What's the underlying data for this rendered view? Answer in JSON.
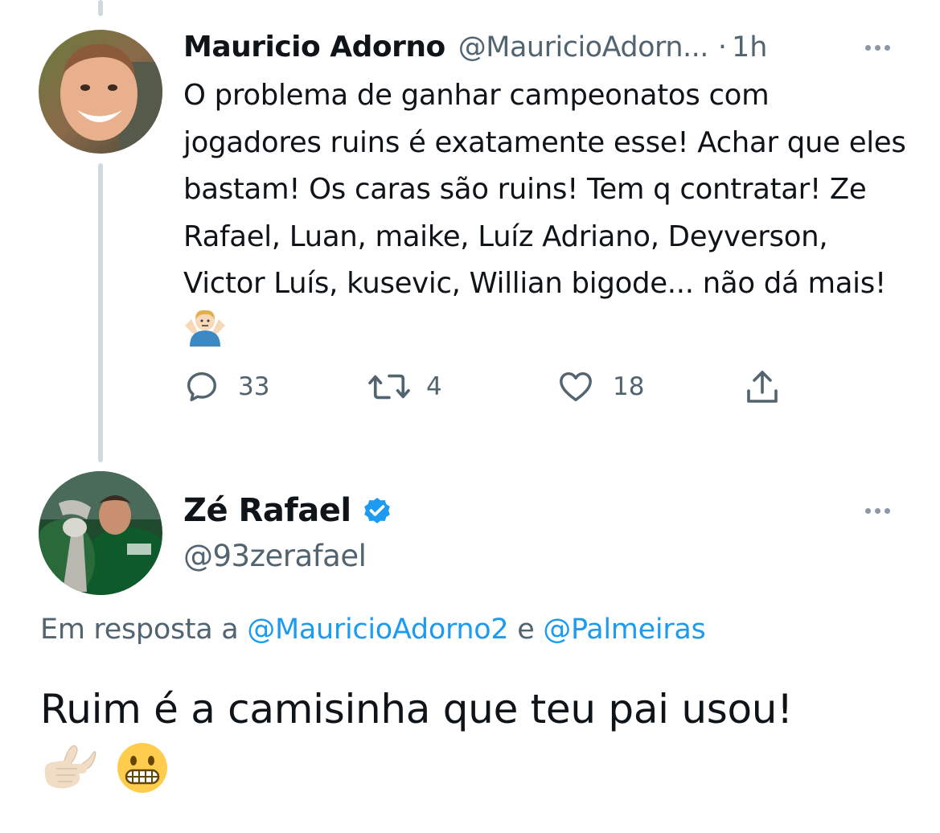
{
  "tweet1": {
    "name": "Mauricio Adorno",
    "handle": "@MauricioAdorn...",
    "separator": "·",
    "time": "1h",
    "text": "O problema de ganhar campeonatos com jogadores ruins é exatamente esse! Achar que eles bastam! Os caras são ruins! Tem q contratar! Ze Rafael, Luan, maike, Luíz Adriano, Deyverson, Victor Luís, kusevic, Willian bigode... não dá mais!",
    "text_emoji": "man-shrugging-emoji",
    "replies": "33",
    "retweets": "4",
    "likes": "18"
  },
  "tweet2": {
    "name": "Zé Rafael",
    "verified": true,
    "handle": "@93zerafael",
    "reply_prefix": "Em resposta a ",
    "reply_mention_1": "@MauricioAdorno2",
    "reply_joiner": " e ",
    "reply_mention_2": "@Palmeiras",
    "text": "Ruim é a camisinha que teu pai usou!",
    "text_emojis": [
      "call-me-hand-emoji",
      "grimacing-face-emoji"
    ]
  },
  "colors": {
    "text": "#0f1419",
    "secondary": "#536471",
    "link": "#1d9bf0",
    "verified": "#1d9bf0",
    "thread_line": "#cfd9de"
  }
}
